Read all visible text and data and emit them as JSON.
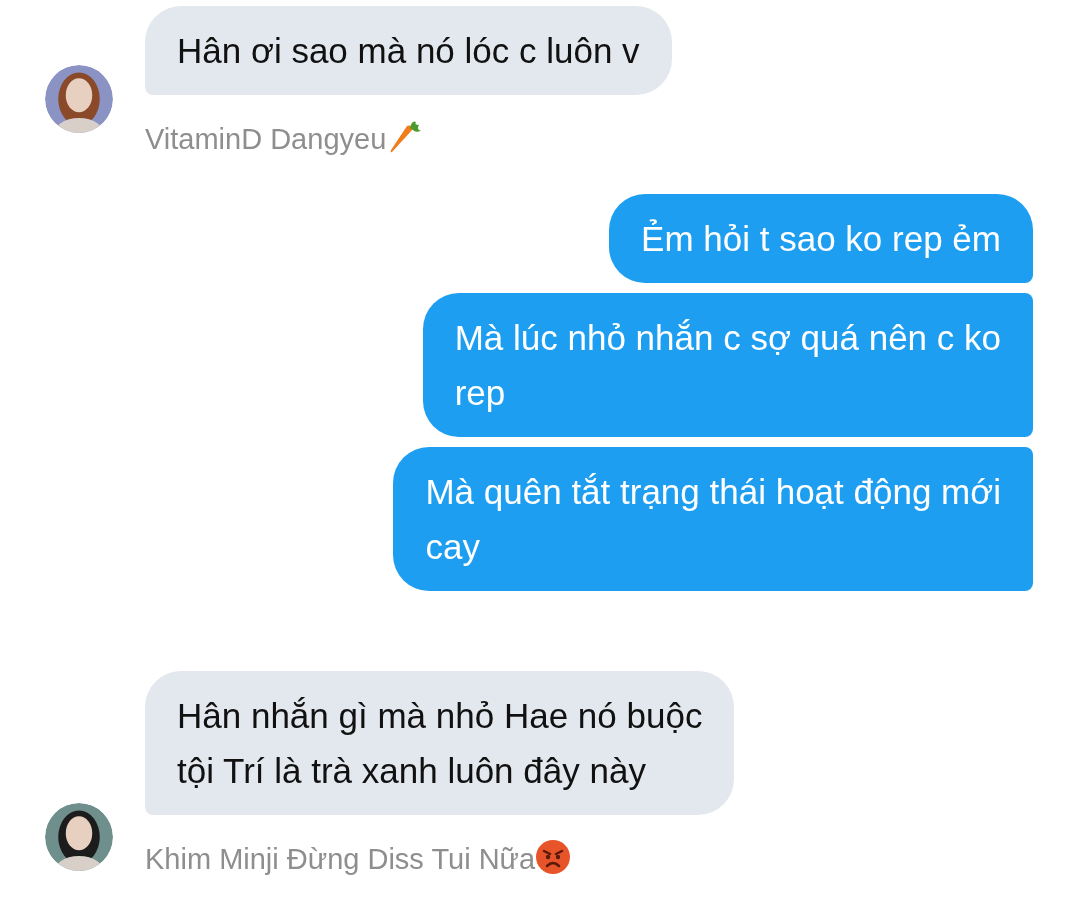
{
  "groups": [
    {
      "kind": "incoming",
      "sender": {
        "name": "VitaminD Dangyeu",
        "kind": "carrot"
      },
      "bubbles": [
        {
          "lines": [
            "Hân ơi sao mà nó lóc c luôn v"
          ]
        }
      ]
    },
    {
      "kind": "outgoing",
      "bubbles": [
        {
          "lines": [
            "Ẻm hỏi t sao ko rep ẻm"
          ]
        },
        {
          "lines": [
            "Mà lúc nhỏ nhắn c sợ quá nên c ko",
            "rep"
          ]
        },
        {
          "lines": [
            "Mà quên tắt trạng thái hoạt động mới",
            "cay"
          ]
        }
      ]
    },
    {
      "kind": "incoming",
      "sender": {
        "name": "Khim Minji Đừng Diss Tui Nữa",
        "kind": "angry"
      },
      "bubbles": [
        {
          "lines": [
            "Hân nhắn gì mà nhỏ Hae nó buộc",
            "tội Trí là trà xanh luôn đây này"
          ]
        }
      ]
    }
  ]
}
